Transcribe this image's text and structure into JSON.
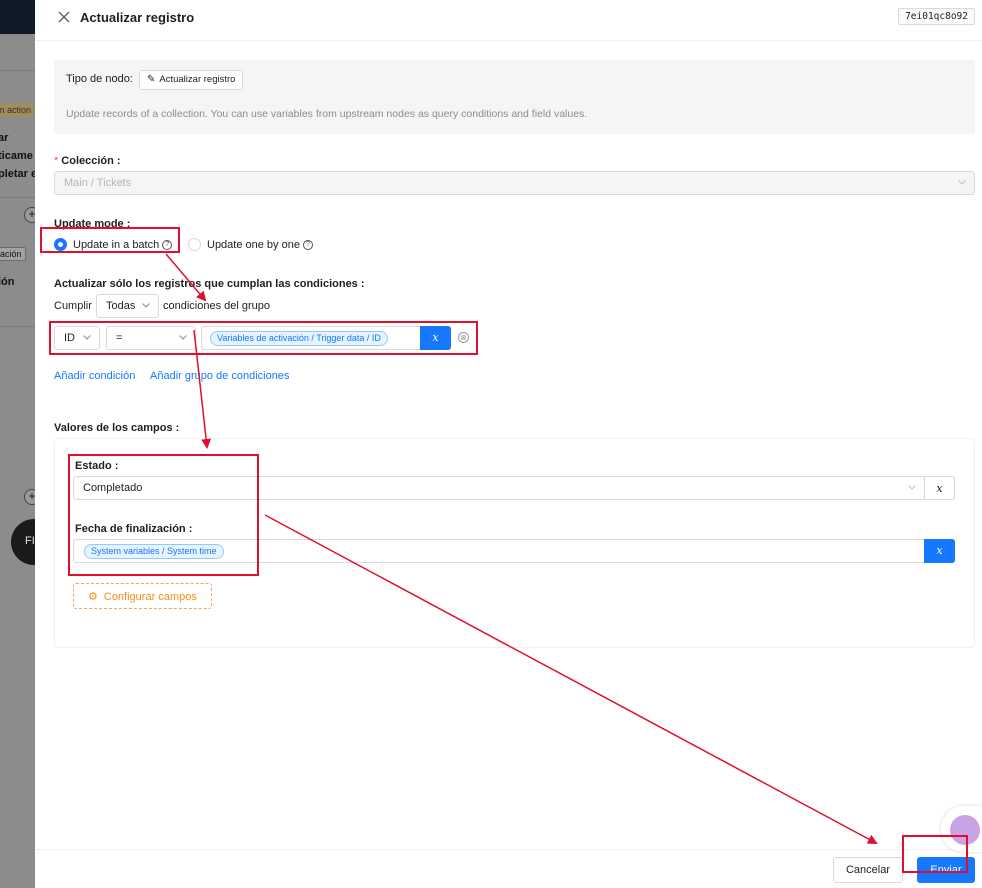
{
  "background": {
    "badge": "m action",
    "text_lines": [
      "ar",
      "ticame",
      "pletar e"
    ],
    "chip": "ación",
    "section_text": "ión",
    "circle_text": "FI",
    "plus": "+"
  },
  "drawer": {
    "title": "Actualizar registro",
    "node_id": "7ei01qc8o92",
    "info": {
      "node_type_label": "Tipo de nodo:",
      "node_type_button": "Actualizar registro",
      "description": "Update records of a collection. You can use variables from upstream nodes as query conditions and field values."
    },
    "collection": {
      "label": "Colección",
      "required_mark": "*",
      "value": "Main / Tickets"
    },
    "update_mode": {
      "label": "Update mode",
      "options": [
        {
          "label": "Update in a batch",
          "checked": true
        },
        {
          "label": "Update one by one",
          "checked": false
        }
      ],
      "help_glyph": "?"
    },
    "conditions": {
      "label": "Actualizar sólo los registros que cumplan las condiciones",
      "prefix": "Cumplir",
      "match_value": "Todas",
      "suffix": "condiciones del grupo",
      "rows": [
        {
          "field": "ID",
          "operator": "=",
          "value_tag": "Variables de activación / Trigger data / ID",
          "var_glyph": "x"
        }
      ],
      "add_condition": "Añadir condición",
      "add_group": "Añadir grupo de condiciones",
      "remove_glyph": "⊗"
    },
    "field_values": {
      "label": "Valores de los campos",
      "fields": [
        {
          "label": "Estado",
          "value": "Completado",
          "var_glyph": "x"
        },
        {
          "label": "Fecha de finalización",
          "value_tag": "System variables / System time",
          "var_glyph": "x"
        }
      ],
      "configure_button": "Configurar campos"
    },
    "footer": {
      "cancel": "Cancelar",
      "submit": "Enviar"
    }
  },
  "colors": {
    "primary": "#1677ff",
    "annotation": "#e0102d",
    "config_button": "#fa8c16"
  }
}
